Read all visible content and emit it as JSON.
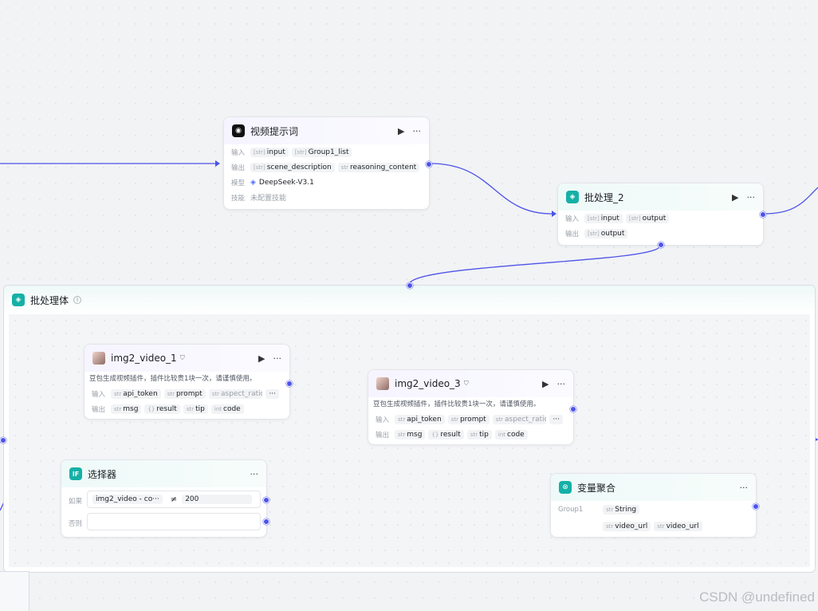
{
  "nodes": {
    "video_prompt": {
      "title": "视频提示词",
      "input_label": "输入",
      "output_label": "输出",
      "model_label": "模型",
      "skill_label": "技能",
      "input_type": "[str]",
      "input_name": "input",
      "input2_type": "[str]",
      "input2_name": "Group1_list",
      "output1_type": "[str]",
      "output1_name": "scene_description",
      "output2_type": "str",
      "output2_name": "reasoning_content",
      "model": "DeepSeek-V3.1",
      "skill": "未配置技能"
    },
    "batch2": {
      "title": "批处理_2",
      "input_label": "输入",
      "output_label": "输出",
      "in1_type": "[str]",
      "in1_name": "input",
      "in2_type": "[str]",
      "in2_name": "output",
      "out1_type": "[str]",
      "out1_name": "output"
    },
    "batch_body": {
      "title": "批处理体"
    },
    "img2_video_1": {
      "title": "img2_video_1",
      "desc": "豆包生成视频插件，插件比较贵1块一次，请谨慎使用。",
      "input_label": "输入",
      "output_label": "输出",
      "in1_type": "str",
      "in1_name": "api_token",
      "in2_type": "str",
      "in2_name": "prompt",
      "in3_type": "str",
      "in3_name": "aspect_ratio",
      "more": "···",
      "out1_type": "str",
      "out1_name": "msg",
      "out2_type": "{}",
      "out2_name": "result",
      "out3_type": "str",
      "out3_name": "tip",
      "out4_type": "int",
      "out4_name": "code"
    },
    "img2_video_3": {
      "title": "img2_video_3",
      "desc": "豆包生成视频插件，插件比较贵1块一次，请谨慎使用。",
      "input_label": "输入",
      "output_label": "输出",
      "in1_type": "str",
      "in1_name": "api_token",
      "in2_type": "str",
      "in2_name": "prompt",
      "in3_type": "str",
      "in3_name": "aspect_ratio",
      "more": "···",
      "out1_type": "str",
      "out1_name": "msg",
      "out2_type": "{}",
      "out2_name": "result",
      "out3_type": "str",
      "out3_name": "tip",
      "out4_type": "int",
      "out4_name": "code"
    },
    "selector": {
      "title": "选择器",
      "if_label": "如果",
      "else_label": "否则",
      "cond_left": "img2_video  -  co···",
      "cond_op": "≠",
      "cond_right": "200"
    },
    "var_agg": {
      "title": "变量聚合",
      "group_label": "Group1",
      "type1": "str",
      "name1": "String",
      "type2": "str",
      "name2": "video_url",
      "type3": "str",
      "name3": "video_url"
    }
  },
  "icons": {
    "run": "play-icon",
    "more": "more-icon",
    "info": "info-icon"
  },
  "colors": {
    "edge": "#4d53e8",
    "teal_icon": "#15b0a6"
  },
  "watermark": "CSDN @undefined"
}
